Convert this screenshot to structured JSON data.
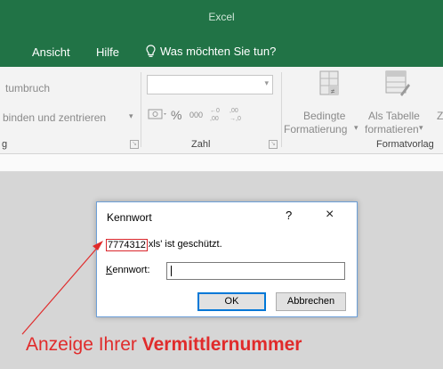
{
  "app": {
    "title": "Excel"
  },
  "menu": {
    "items": [
      "Ansicht",
      "Hilfe"
    ],
    "tell_me": "Was möchten Sie tun?"
  },
  "ribbon": {
    "wrap_text": "tumbruch",
    "merge_center": "binden und zentrieren",
    "alignment_group": "g",
    "number_group": "Zahl",
    "percent": "%",
    "thousands": "000",
    "conditional_line1": "Bedingte",
    "conditional_line2": "Formatierung",
    "as_table_line1": "Als Tabelle",
    "as_table_line2": "formatieren",
    "styles_group": "Formatvorlag",
    "partial_z": "Z"
  },
  "dialog": {
    "title": "Kennwort",
    "help": "?",
    "close": "×",
    "file_number": "7774312",
    "message_rest": "xls' ist geschützt.",
    "field_label_accel": "K",
    "field_label_rest": "ennwort:",
    "field_value": "",
    "ok": "OK",
    "cancel": "Abbrechen"
  },
  "annotation": {
    "prefix": "Anzeige Ihrer ",
    "bold": "Vermittlernummer"
  }
}
